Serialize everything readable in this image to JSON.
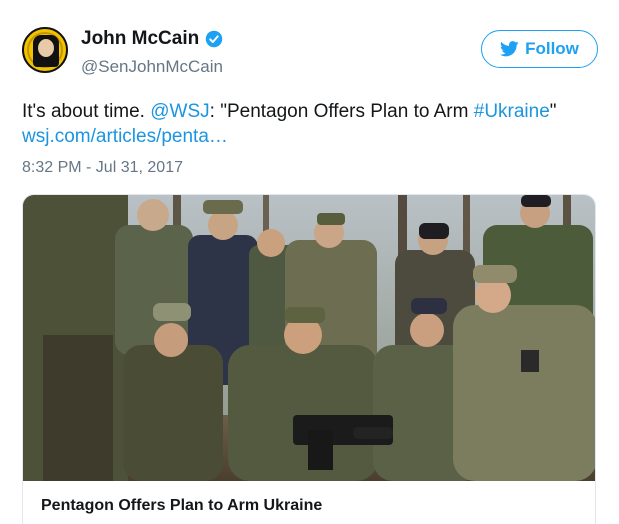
{
  "author": {
    "display_name": "John McCain",
    "handle": "@SenJohnMcCain",
    "verified": true
  },
  "follow_button": {
    "label": "Follow",
    "icon": "twitter-bird-icon"
  },
  "tweet": {
    "text_prefix": "It's about time. ",
    "mention": "@WSJ",
    "text_middle": ": \"Pentagon Offers Plan to Arm ",
    "hashtag": "#Ukraine",
    "text_suffix": "\"",
    "link_text": "wsj.com/articles/penta…",
    "timestamp": "8:32 PM - Jul 31, 2017"
  },
  "card": {
    "title": "Pentagon Offers Plan to Arm Ukraine",
    "image_description_icon": "soldiers-photo"
  },
  "colors": {
    "accent": "#1da1f2",
    "link": "#1b95e0",
    "secondary_text": "#657786"
  }
}
